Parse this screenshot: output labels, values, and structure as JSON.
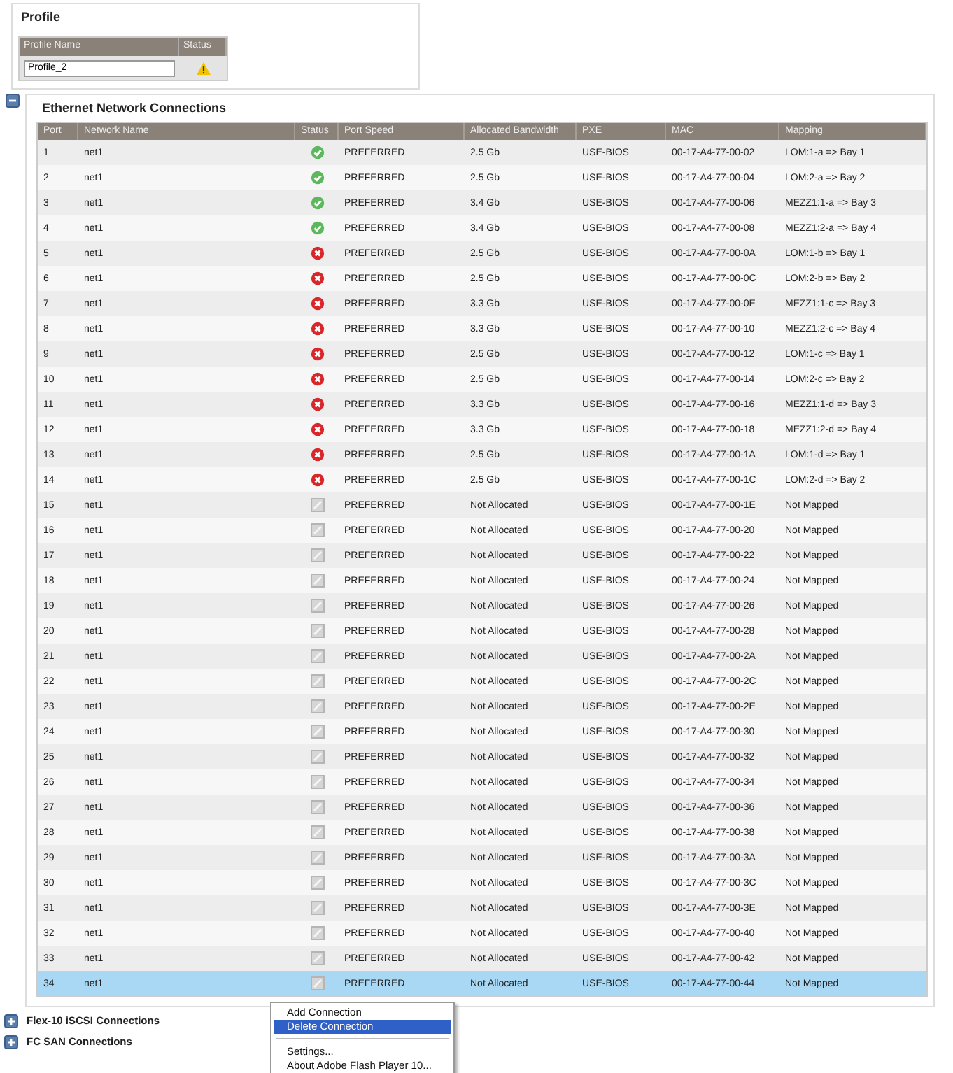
{
  "profile": {
    "title": "Profile",
    "columns": [
      "Profile Name",
      "Status"
    ],
    "name_value": "Profile_2",
    "status": {
      "kind": "warning"
    }
  },
  "ethernet": {
    "title": "Ethernet Network Connections",
    "expanded": true,
    "columns": [
      "Port",
      "Network Name",
      "Status",
      "Port Speed",
      "Allocated Bandwidth",
      "PXE",
      "MAC",
      "Mapping"
    ],
    "rows": [
      {
        "port": "1",
        "network": "net1",
        "status": {
          "kind": "ok"
        },
        "speed": "PREFERRED",
        "bandwidth": "2.5 Gb",
        "pxe": "USE-BIOS",
        "mac": "00-17-A4-77-00-02",
        "mapping": "LOM:1-a => Bay 1",
        "selected": false
      },
      {
        "port": "2",
        "network": "net1",
        "status": {
          "kind": "ok"
        },
        "speed": "PREFERRED",
        "bandwidth": "2.5 Gb",
        "pxe": "USE-BIOS",
        "mac": "00-17-A4-77-00-04",
        "mapping": "LOM:2-a => Bay 2",
        "selected": false
      },
      {
        "port": "3",
        "network": "net1",
        "status": {
          "kind": "ok"
        },
        "speed": "PREFERRED",
        "bandwidth": "3.4 Gb",
        "pxe": "USE-BIOS",
        "mac": "00-17-A4-77-00-06",
        "mapping": "MEZZ1:1-a => Bay 3",
        "selected": false
      },
      {
        "port": "4",
        "network": "net1",
        "status": {
          "kind": "ok"
        },
        "speed": "PREFERRED",
        "bandwidth": "3.4 Gb",
        "pxe": "USE-BIOS",
        "mac": "00-17-A4-77-00-08",
        "mapping": "MEZZ1:2-a => Bay 4",
        "selected": false
      },
      {
        "port": "5",
        "network": "net1",
        "status": {
          "kind": "error"
        },
        "speed": "PREFERRED",
        "bandwidth": "2.5 Gb",
        "pxe": "USE-BIOS",
        "mac": "00-17-A4-77-00-0A",
        "mapping": "LOM:1-b => Bay 1",
        "selected": false
      },
      {
        "port": "6",
        "network": "net1",
        "status": {
          "kind": "error"
        },
        "speed": "PREFERRED",
        "bandwidth": "2.5 Gb",
        "pxe": "USE-BIOS",
        "mac": "00-17-A4-77-00-0C",
        "mapping": "LOM:2-b => Bay 2",
        "selected": false
      },
      {
        "port": "7",
        "network": "net1",
        "status": {
          "kind": "error"
        },
        "speed": "PREFERRED",
        "bandwidth": "3.3 Gb",
        "pxe": "USE-BIOS",
        "mac": "00-17-A4-77-00-0E",
        "mapping": "MEZZ1:1-c => Bay 3",
        "selected": false
      },
      {
        "port": "8",
        "network": "net1",
        "status": {
          "kind": "error"
        },
        "speed": "PREFERRED",
        "bandwidth": "3.3 Gb",
        "pxe": "USE-BIOS",
        "mac": "00-17-A4-77-00-10",
        "mapping": "MEZZ1:2-c => Bay 4",
        "selected": false
      },
      {
        "port": "9",
        "network": "net1",
        "status": {
          "kind": "error"
        },
        "speed": "PREFERRED",
        "bandwidth": "2.5 Gb",
        "pxe": "USE-BIOS",
        "mac": "00-17-A4-77-00-12",
        "mapping": "LOM:1-c => Bay 1",
        "selected": false
      },
      {
        "port": "10",
        "network": "net1",
        "status": {
          "kind": "error"
        },
        "speed": "PREFERRED",
        "bandwidth": "2.5 Gb",
        "pxe": "USE-BIOS",
        "mac": "00-17-A4-77-00-14",
        "mapping": "LOM:2-c => Bay 2",
        "selected": false
      },
      {
        "port": "11",
        "network": "net1",
        "status": {
          "kind": "error"
        },
        "speed": "PREFERRED",
        "bandwidth": "3.3 Gb",
        "pxe": "USE-BIOS",
        "mac": "00-17-A4-77-00-16",
        "mapping": "MEZZ1:1-d => Bay 3",
        "selected": false
      },
      {
        "port": "12",
        "network": "net1",
        "status": {
          "kind": "error"
        },
        "speed": "PREFERRED",
        "bandwidth": "3.3 Gb",
        "pxe": "USE-BIOS",
        "mac": "00-17-A4-77-00-18",
        "mapping": "MEZZ1:2-d => Bay 4",
        "selected": false
      },
      {
        "port": "13",
        "network": "net1",
        "status": {
          "kind": "error"
        },
        "speed": "PREFERRED",
        "bandwidth": "2.5 Gb",
        "pxe": "USE-BIOS",
        "mac": "00-17-A4-77-00-1A",
        "mapping": "LOM:1-d => Bay 1",
        "selected": false
      },
      {
        "port": "14",
        "network": "net1",
        "status": {
          "kind": "error"
        },
        "speed": "PREFERRED",
        "bandwidth": "2.5 Gb",
        "pxe": "USE-BIOS",
        "mac": "00-17-A4-77-00-1C",
        "mapping": "LOM:2-d => Bay 2",
        "selected": false
      },
      {
        "port": "15",
        "network": "net1",
        "status": {
          "kind": "unassigned"
        },
        "speed": "PREFERRED",
        "bandwidth": "Not Allocated",
        "pxe": "USE-BIOS",
        "mac": "00-17-A4-77-00-1E",
        "mapping": "Not Mapped",
        "selected": false
      },
      {
        "port": "16",
        "network": "net1",
        "status": {
          "kind": "unassigned"
        },
        "speed": "PREFERRED",
        "bandwidth": "Not Allocated",
        "pxe": "USE-BIOS",
        "mac": "00-17-A4-77-00-20",
        "mapping": "Not Mapped",
        "selected": false
      },
      {
        "port": "17",
        "network": "net1",
        "status": {
          "kind": "unassigned"
        },
        "speed": "PREFERRED",
        "bandwidth": "Not Allocated",
        "pxe": "USE-BIOS",
        "mac": "00-17-A4-77-00-22",
        "mapping": "Not Mapped",
        "selected": false
      },
      {
        "port": "18",
        "network": "net1",
        "status": {
          "kind": "unassigned"
        },
        "speed": "PREFERRED",
        "bandwidth": "Not Allocated",
        "pxe": "USE-BIOS",
        "mac": "00-17-A4-77-00-24",
        "mapping": "Not Mapped",
        "selected": false
      },
      {
        "port": "19",
        "network": "net1",
        "status": {
          "kind": "unassigned"
        },
        "speed": "PREFERRED",
        "bandwidth": "Not Allocated",
        "pxe": "USE-BIOS",
        "mac": "00-17-A4-77-00-26",
        "mapping": "Not Mapped",
        "selected": false
      },
      {
        "port": "20",
        "network": "net1",
        "status": {
          "kind": "unassigned"
        },
        "speed": "PREFERRED",
        "bandwidth": "Not Allocated",
        "pxe": "USE-BIOS",
        "mac": "00-17-A4-77-00-28",
        "mapping": "Not Mapped",
        "selected": false
      },
      {
        "port": "21",
        "network": "net1",
        "status": {
          "kind": "unassigned"
        },
        "speed": "PREFERRED",
        "bandwidth": "Not Allocated",
        "pxe": "USE-BIOS",
        "mac": "00-17-A4-77-00-2A",
        "mapping": "Not Mapped",
        "selected": false
      },
      {
        "port": "22",
        "network": "net1",
        "status": {
          "kind": "unassigned"
        },
        "speed": "PREFERRED",
        "bandwidth": "Not Allocated",
        "pxe": "USE-BIOS",
        "mac": "00-17-A4-77-00-2C",
        "mapping": "Not Mapped",
        "selected": false
      },
      {
        "port": "23",
        "network": "net1",
        "status": {
          "kind": "unassigned"
        },
        "speed": "PREFERRED",
        "bandwidth": "Not Allocated",
        "pxe": "USE-BIOS",
        "mac": "00-17-A4-77-00-2E",
        "mapping": "Not Mapped",
        "selected": false
      },
      {
        "port": "24",
        "network": "net1",
        "status": {
          "kind": "unassigned"
        },
        "speed": "PREFERRED",
        "bandwidth": "Not Allocated",
        "pxe": "USE-BIOS",
        "mac": "00-17-A4-77-00-30",
        "mapping": "Not Mapped",
        "selected": false
      },
      {
        "port": "25",
        "network": "net1",
        "status": {
          "kind": "unassigned"
        },
        "speed": "PREFERRED",
        "bandwidth": "Not Allocated",
        "pxe": "USE-BIOS",
        "mac": "00-17-A4-77-00-32",
        "mapping": "Not Mapped",
        "selected": false
      },
      {
        "port": "26",
        "network": "net1",
        "status": {
          "kind": "unassigned"
        },
        "speed": "PREFERRED",
        "bandwidth": "Not Allocated",
        "pxe": "USE-BIOS",
        "mac": "00-17-A4-77-00-34",
        "mapping": "Not Mapped",
        "selected": false
      },
      {
        "port": "27",
        "network": "net1",
        "status": {
          "kind": "unassigned"
        },
        "speed": "PREFERRED",
        "bandwidth": "Not Allocated",
        "pxe": "USE-BIOS",
        "mac": "00-17-A4-77-00-36",
        "mapping": "Not Mapped",
        "selected": false
      },
      {
        "port": "28",
        "network": "net1",
        "status": {
          "kind": "unassigned"
        },
        "speed": "PREFERRED",
        "bandwidth": "Not Allocated",
        "pxe": "USE-BIOS",
        "mac": "00-17-A4-77-00-38",
        "mapping": "Not Mapped",
        "selected": false
      },
      {
        "port": "29",
        "network": "net1",
        "status": {
          "kind": "unassigned"
        },
        "speed": "PREFERRED",
        "bandwidth": "Not Allocated",
        "pxe": "USE-BIOS",
        "mac": "00-17-A4-77-00-3A",
        "mapping": "Not Mapped",
        "selected": false
      },
      {
        "port": "30",
        "network": "net1",
        "status": {
          "kind": "unassigned"
        },
        "speed": "PREFERRED",
        "bandwidth": "Not Allocated",
        "pxe": "USE-BIOS",
        "mac": "00-17-A4-77-00-3C",
        "mapping": "Not Mapped",
        "selected": false
      },
      {
        "port": "31",
        "network": "net1",
        "status": {
          "kind": "unassigned"
        },
        "speed": "PREFERRED",
        "bandwidth": "Not Allocated",
        "pxe": "USE-BIOS",
        "mac": "00-17-A4-77-00-3E",
        "mapping": "Not Mapped",
        "selected": false
      },
      {
        "port": "32",
        "network": "net1",
        "status": {
          "kind": "unassigned"
        },
        "speed": "PREFERRED",
        "bandwidth": "Not Allocated",
        "pxe": "USE-BIOS",
        "mac": "00-17-A4-77-00-40",
        "mapping": "Not Mapped",
        "selected": false
      },
      {
        "port": "33",
        "network": "net1",
        "status": {
          "kind": "unassigned"
        },
        "speed": "PREFERRED",
        "bandwidth": "Not Allocated",
        "pxe": "USE-BIOS",
        "mac": "00-17-A4-77-00-42",
        "mapping": "Not Mapped",
        "selected": false
      },
      {
        "port": "34",
        "network": "net1",
        "status": {
          "kind": "unassigned"
        },
        "speed": "PREFERRED",
        "bandwidth": "Not Allocated",
        "pxe": "USE-BIOS",
        "mac": "00-17-A4-77-00-44",
        "mapping": "Not Mapped",
        "selected": true
      }
    ]
  },
  "context_menu": [
    {
      "kind": "item",
      "label": "Add Connection",
      "selected": false
    },
    {
      "kind": "item",
      "label": "Delete Connection",
      "selected": true
    },
    {
      "kind": "separator"
    },
    {
      "kind": "item",
      "label": "Settings...",
      "selected": false
    },
    {
      "kind": "item",
      "label": "About Adobe Flash Player 10...",
      "selected": false
    }
  ],
  "sections": [
    {
      "title": "Flex-10 iSCSI Connections",
      "expanded": false
    },
    {
      "title": "FC SAN Connections",
      "expanded": false
    }
  ]
}
